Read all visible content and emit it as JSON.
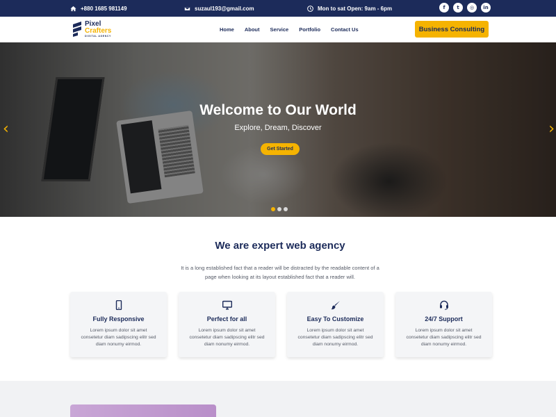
{
  "topbar": {
    "phone": "+880 1685 981149",
    "email": "suzaul193@gmail.com",
    "hours": "Mon to sat Open: 9am - 6pm",
    "social": [
      {
        "icon": "facebook-icon",
        "glyph": "f"
      },
      {
        "icon": "twitter-icon",
        "glyph": "t"
      },
      {
        "icon": "instagram-icon",
        "glyph": "◎"
      },
      {
        "icon": "linkedin-icon",
        "glyph": "in"
      }
    ]
  },
  "logo": {
    "line1": "Pixel",
    "line2": "Crafters",
    "tagline": "DIGITAL AGENCY"
  },
  "nav": {
    "items": [
      "Home",
      "About",
      "Service",
      "Portfolio",
      "Contact Us"
    ],
    "cta": "Business Consulting"
  },
  "hero": {
    "title": "Welcome to Our World",
    "subtitle": "Explore, Dream, Discover",
    "button": "Get Started",
    "slide_count": 3,
    "active_slide": 1
  },
  "services": {
    "title": "We are expert web agency",
    "description": "It is a long established fact that a reader will be distracted by the readable content of a page when looking at its layout established fact that a reader will.",
    "cards": [
      {
        "icon": "mobile-icon",
        "title": "Fully Responsive",
        "text": "Lorem ipsum dolor sit amet consetetur diam sadipscing elitr sed diam nonumy eirmod."
      },
      {
        "icon": "monitor-icon",
        "title": "Perfect for all",
        "text": "Lorem ipsum dolor sit amet consetetur diam sadipscing elitr sed diam nonumy eirmod."
      },
      {
        "icon": "brush-icon",
        "title": "Easy To Customize",
        "text": "Lorem ipsum dolor sit amet consetetur diam sadipscing elitr sed diam nonumy eirmod."
      },
      {
        "icon": "headset-icon",
        "title": "24/7 Support",
        "text": "Lorem ipsum dolor sit amet consetetur diam sadipscing elitr sed diam nonumy eirmod."
      }
    ]
  },
  "colors": {
    "primary": "#1c2b5a",
    "accent": "#f5b301"
  }
}
